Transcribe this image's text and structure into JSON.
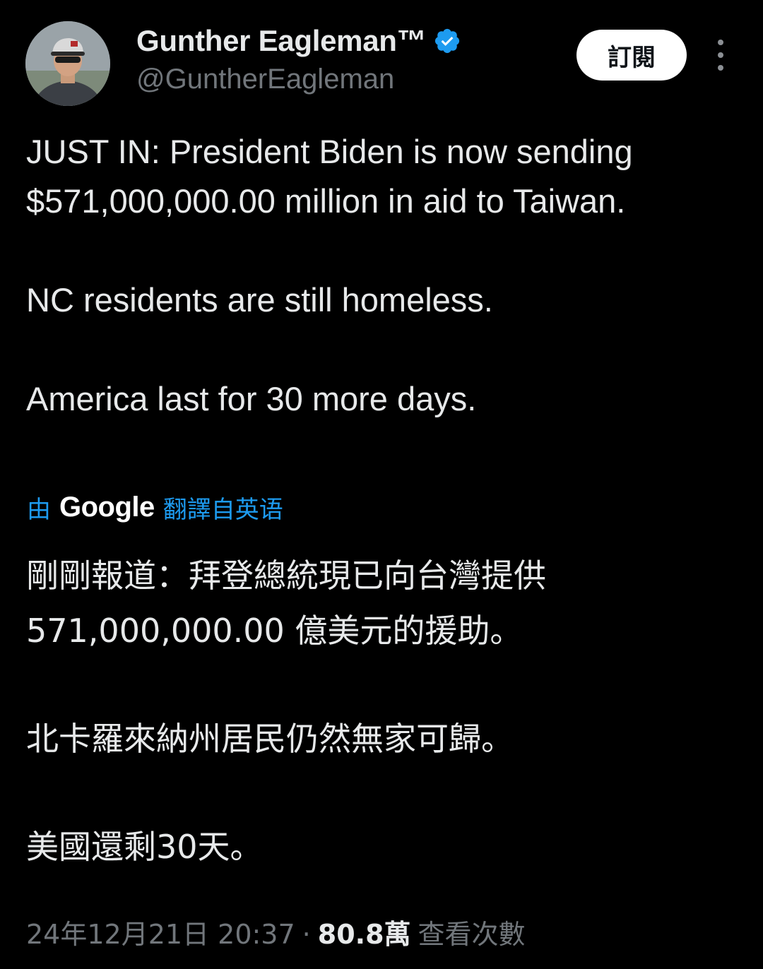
{
  "author": {
    "display_name": "Gunther Eagleman™",
    "handle": "@GuntherEagleman",
    "verified": true
  },
  "actions": {
    "subscribe_label": "訂閱",
    "more_icon": "more-vertical-icon"
  },
  "tweet": {
    "lines": [
      "JUST IN: President Biden is now sending $571,000,000.00 million in aid to Taiwan.",
      "NC residents are still homeless.",
      "America last for 30 more days."
    ]
  },
  "translation": {
    "by_label": "由",
    "provider": "Google",
    "from_label": "翻譯自英语",
    "lines": [
      "剛剛報道：拜登總統現已向台灣提供 571,000,000.00 億美元的援助。",
      "北卡羅來納州居民仍然無家可歸。",
      "美國還剩30天。"
    ]
  },
  "meta": {
    "timestamp": "24年12月21日 20:37",
    "separator": "·",
    "views_count": "80.8萬",
    "views_label": "查看次數"
  },
  "colors": {
    "background": "#000000",
    "text": "#e7e9ea",
    "muted": "#71767b",
    "accent": "#1d9bf0"
  }
}
